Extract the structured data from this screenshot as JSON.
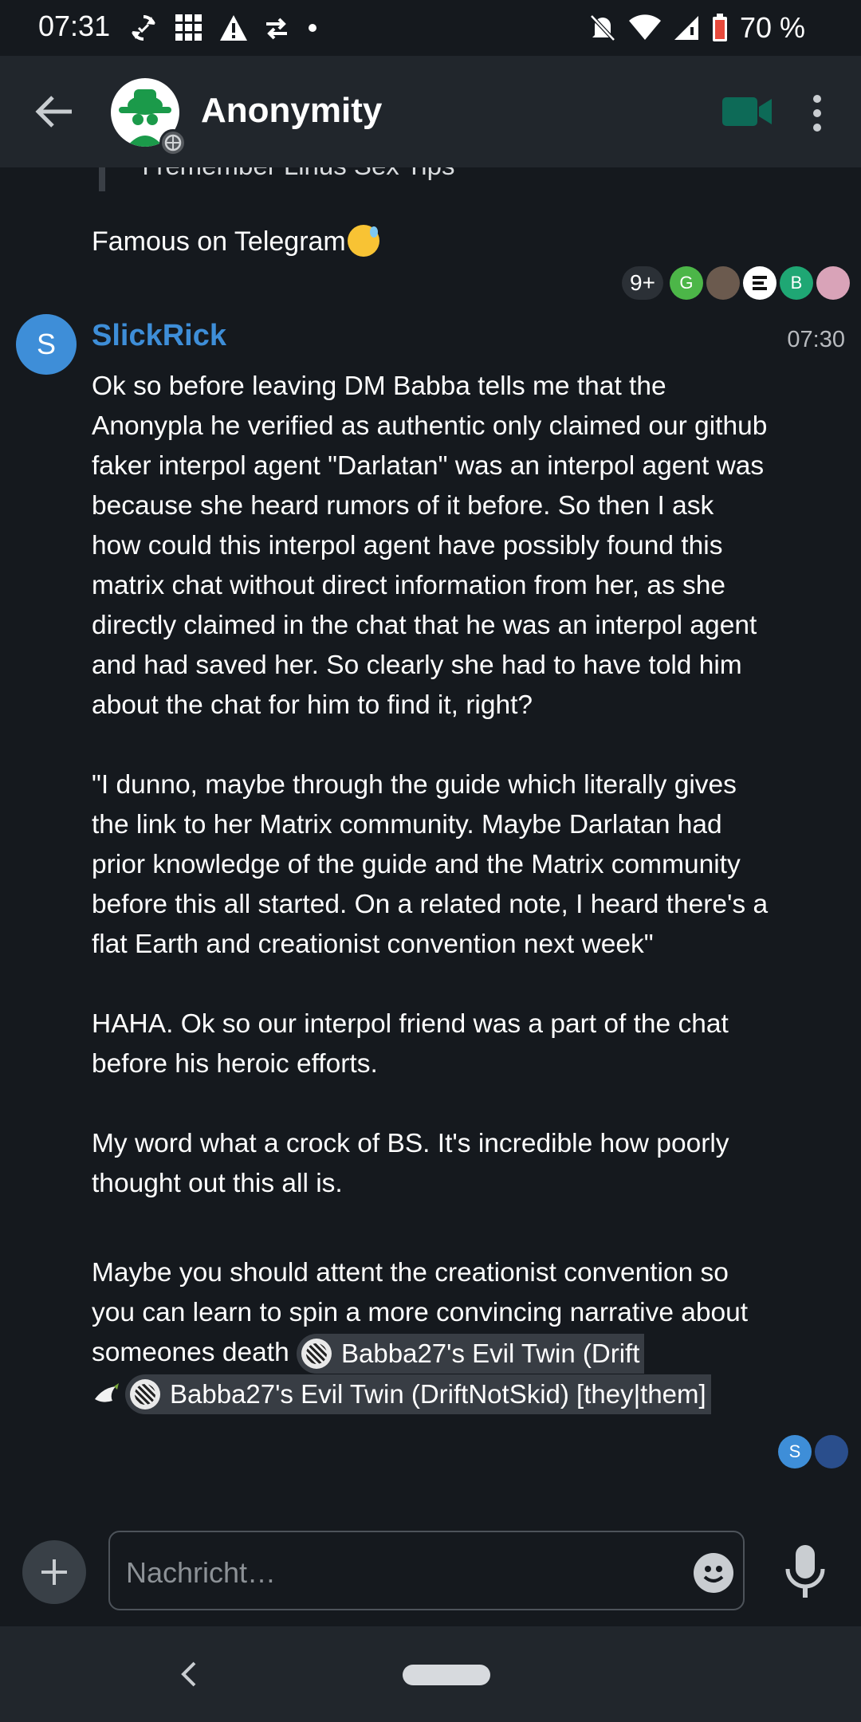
{
  "status_bar": {
    "time": "07:31",
    "battery_percent": "70 %",
    "left_icons": [
      "sync-icon",
      "grid-icon",
      "warning-icon",
      "data-swap-icon",
      "dot-icon"
    ],
    "right_icons": [
      "mute-icon",
      "wifi-icon",
      "signal-icon",
      "battery-icon"
    ]
  },
  "app_bar": {
    "room_name": "Anonymity",
    "icons": [
      "back-arrow-icon",
      "room-avatar",
      "globe-badge-icon",
      "video-call-icon",
      "more-vert-icon"
    ]
  },
  "timeline": {
    "partial_quote": "I remember Linus Sex Tips",
    "previous_message": "Famous on Telegram",
    "previous_receipts": {
      "count_label": "9+",
      "avatars": [
        {
          "letter": "G",
          "color": "#4cb648"
        },
        {
          "letter": "",
          "color": "#6b5a4e"
        },
        {
          "letter": "",
          "color": "#ffffff"
        },
        {
          "letter": "B",
          "color": "#1fa774"
        },
        {
          "letter": "",
          "color": "#d9a3b8"
        }
      ]
    },
    "message": {
      "sender_initial": "S",
      "sender_name": "SlickRick",
      "time": "07:30",
      "paragraphs": [
        "Ok so before leaving DM Babba tells me that the Anonypla he verified as authentic only claimed our github faker interpol agent \"Darlatan\" was an interpol agent was because she heard rumors of it before. So then I ask how could this interpol agent have possibly found this matrix chat without direct information from her, as she directly claimed in the chat that he was an interpol agent and had saved her. So clearly she had to have told him about the chat for him to find it, right?",
        "\"I dunno, maybe through the guide which literally gives the link to her Matrix community. Maybe Darlatan had prior knowledge of the guide and the Matrix community before this all started. On a related note, I heard there's a flat Earth and creationist convention next week\"",
        "HAHA. Ok so our interpol friend was a part of the chat before his heroic efforts.",
        "My word what a crock of BS. It's incredible how poorly thought out this all is."
      ]
    },
    "message2": {
      "text": "Maybe you should attent the creationist convention so you can learn to spin a more convincing narrative about someones death",
      "pill1": "Babba27's Evil Twin (Drift",
      "pill2": "Babba27's Evil Twin (DriftNotSkid) [they|them]"
    },
    "receipts2": [
      {
        "letter": "S",
        "color": "#3e8ed8"
      },
      {
        "letter": "",
        "color": "#2a4e8c"
      }
    ]
  },
  "composer": {
    "placeholder": "Nachricht…",
    "icons": [
      "add-icon",
      "emoji-icon",
      "mic-icon"
    ]
  },
  "nav_bar": {
    "icons": [
      "nav-back-icon",
      "home-pill"
    ]
  },
  "colors": {
    "background": "#15191e",
    "header": "#21262c",
    "accent_blue": "#3e8ed8",
    "video_green": "#0d6a57"
  }
}
